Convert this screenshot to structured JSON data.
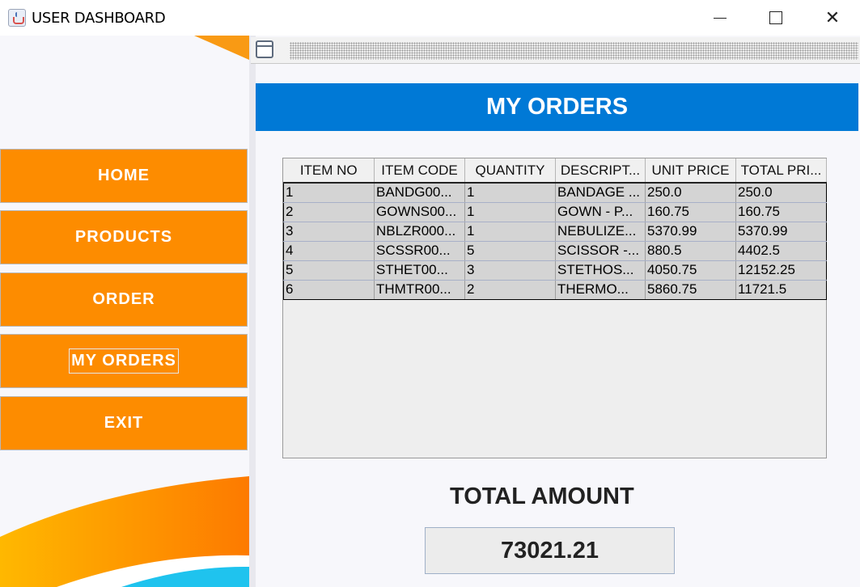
{
  "window": {
    "title": "USER DASHBOARD",
    "icon": "java-cup-icon",
    "controls": {
      "minimize": "minimize-icon",
      "maximize": "maximize-icon",
      "close": "✕"
    }
  },
  "sidebar": {
    "items": [
      {
        "label": "HOME"
      },
      {
        "label": "PRODUCTS"
      },
      {
        "label": "ORDER"
      },
      {
        "label": "MY ORDERS",
        "focused": true
      },
      {
        "label": "EXIT"
      }
    ],
    "button_color": "#fd8c00"
  },
  "main": {
    "heading": "MY ORDERS",
    "heading_color": "#0079d6",
    "table": {
      "columns": [
        "ITEM NO",
        "ITEM CODE",
        "QUANTITY",
        "DESCRIPT...",
        "UNIT PRICE",
        "TOTAL PRI..."
      ],
      "rows": [
        [
          "1",
          "BANDG00...",
          "1",
          "BANDAGE ...",
          "250.0",
          "250.0"
        ],
        [
          "2",
          "GOWNS00...",
          "1",
          "GOWN - P...",
          "160.75",
          "160.75"
        ],
        [
          "3",
          "NBLZR000...",
          "1",
          "NEBULIZE...",
          "5370.99",
          "5370.99"
        ],
        [
          "4",
          "SCSSR00...",
          "5",
          "SCISSOR -...",
          "880.5",
          "4402.5"
        ],
        [
          "5",
          "STHET00...",
          "3",
          "STETHOS...",
          "4050.75",
          "12152.25"
        ],
        [
          "6",
          "THMTR00...",
          "2",
          "THERMO...",
          "5860.75",
          "11721.5"
        ]
      ]
    },
    "total_label": "TOTAL AMOUNT",
    "total_value": "73021.21"
  }
}
